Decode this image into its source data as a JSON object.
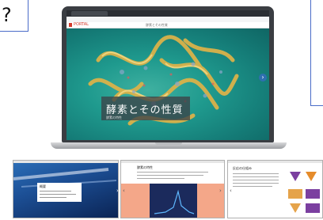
{
  "annotation": {
    "question_mark": "?"
  },
  "browser": {
    "app_logo_text": "PORTAL",
    "app_title": "酵素とその性質"
  },
  "hero": {
    "caption": "酵素とその性質",
    "caption_sub": "酵素の特性",
    "next_icon": "chevron-right-icon"
  },
  "thumbnails": [
    {
      "title": "概要"
    },
    {
      "title": "酵素の特性"
    },
    {
      "title": "反応の仕組み"
    }
  ],
  "colors": {
    "hero_bg": "#1f9a8e",
    "protein": "#d9b24a",
    "logo": "#d33b2c",
    "thumb1": "#1c4f95",
    "thumb2_band": "#f4a789"
  }
}
